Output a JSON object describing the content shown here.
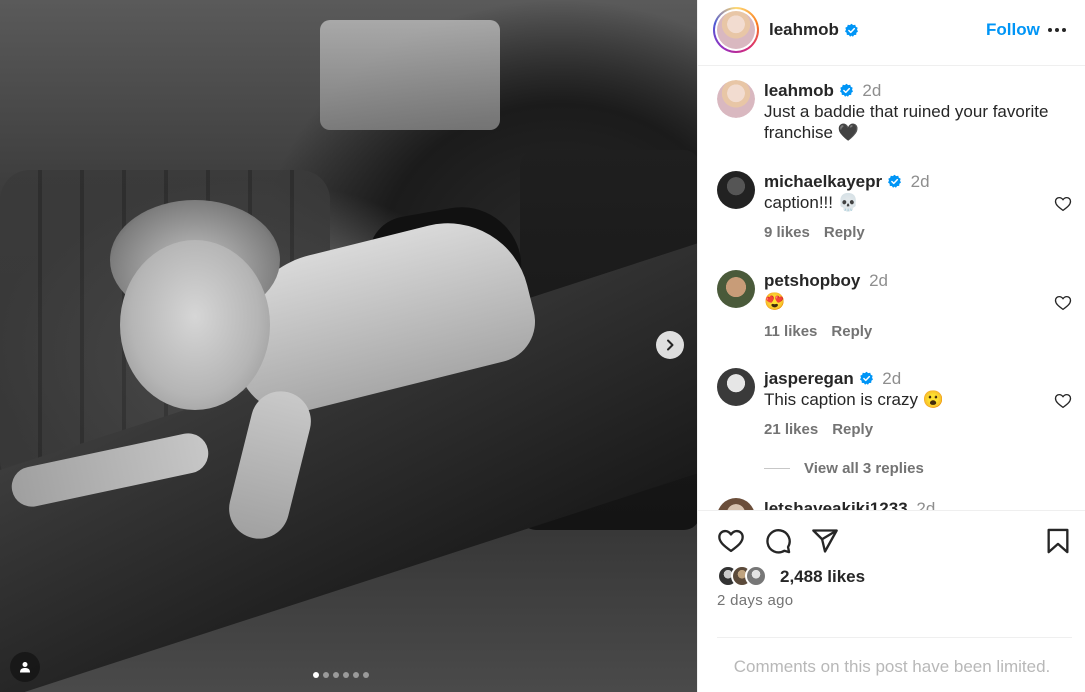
{
  "post": {
    "username": "leahmob",
    "follow_label": "Follow",
    "caption_time": "2d",
    "caption": "Just a baddie that ruined your favorite franchise 🖤",
    "carousel": {
      "total": 6,
      "current": 1
    }
  },
  "comments": [
    {
      "username": "michaelkayepr",
      "verified": true,
      "time": "2d",
      "text": "caption!!! 💀",
      "likes": "9 likes",
      "reply": "Reply"
    },
    {
      "username": "petshopboy",
      "verified": false,
      "time": "2d",
      "text": "😍",
      "likes": "11 likes",
      "reply": "Reply"
    },
    {
      "username": "jasperegan",
      "verified": true,
      "time": "2d",
      "text": "This caption is crazy 😮",
      "likes": "21 likes",
      "reply": "Reply",
      "view_replies": "View all 3 replies"
    },
    {
      "username": "letshaveakiki1233",
      "verified": false,
      "time": "2d",
      "text": ""
    }
  ],
  "footer": {
    "likes": "2,488 likes",
    "posted": "2 days ago",
    "limited": "Comments on this post have been limited."
  },
  "colors": {
    "accent": "#0095f6",
    "verified": "#0095f6",
    "muted": "#737373"
  }
}
